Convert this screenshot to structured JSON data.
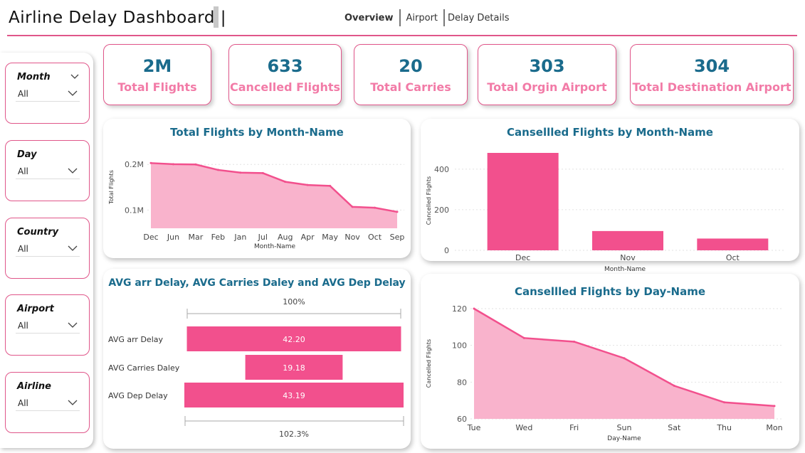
{
  "header": {
    "title": "Airline Delay Dashboard |",
    "nav": [
      {
        "label": "Overview",
        "active": true
      },
      {
        "label": "Airport",
        "active": false
      },
      {
        "label": "Delay Details",
        "active": false
      }
    ]
  },
  "slicers": [
    {
      "label": "Month",
      "value": "All"
    },
    {
      "label": "Day",
      "value": "All"
    },
    {
      "label": "Country",
      "value": "All"
    },
    {
      "label": "Airport",
      "value": "All"
    },
    {
      "label": "Airline",
      "value": "All"
    }
  ],
  "kpis": [
    {
      "value": "2M",
      "label": "Total Flights"
    },
    {
      "value": "633",
      "label": "Cancelled Flights"
    },
    {
      "value": "20",
      "label": "Total Carries"
    },
    {
      "value": "303",
      "label": "Total Orgin Airport"
    },
    {
      "value": "304",
      "label": "Total Destination Airport"
    }
  ],
  "colors": {
    "accent": "#e0568a",
    "bar": "#f2508d",
    "area_fill": "#f9b3cc",
    "title": "#1a6b8c",
    "kpi_label": "#f27ba7"
  },
  "chart_data": [
    {
      "type": "area",
      "title": "Total Flights by Month-Name",
      "xlabel": "Month-Name",
      "ylabel": "Total Flights",
      "categories": [
        "Dec",
        "Jun",
        "Mar",
        "Feb",
        "Jan",
        "Jul",
        "Aug",
        "Apr",
        "May",
        "Nov",
        "Oct",
        "Sep"
      ],
      "values": [
        203000,
        200500,
        200000,
        188000,
        182000,
        181000,
        162000,
        155000,
        153000,
        107000,
        105000,
        96000
      ],
      "yticks": [
        {
          "value": 100000,
          "label": "0.1M"
        },
        {
          "value": 200000,
          "label": "0.2M"
        }
      ],
      "ylim": [
        60000,
        230000
      ]
    },
    {
      "type": "bar",
      "title": "Cancelled Flights by Month-Name",
      "xlabel": "Month-Name",
      "ylabel": "Cancelled Flights",
      "categories": [
        "Dec",
        "Nov",
        "Oct"
      ],
      "values": [
        480,
        95,
        58
      ],
      "yticks": [
        {
          "value": 0,
          "label": "0"
        },
        {
          "value": 200,
          "label": "200"
        },
        {
          "value": 400,
          "label": "400"
        }
      ],
      "ylim": [
        0,
        480
      ]
    },
    {
      "type": "bar",
      "title": "AVG arr Delay, AVG Carries Daley and AVG Dep Delay",
      "orientation": "funnel",
      "categories": [
        "AVG arr Delay",
        "AVG Carries Daley",
        "AVG Dep Delay"
      ],
      "values": [
        42.2,
        19.18,
        43.19
      ],
      "value_labels": [
        "42.20",
        "19.18",
        "43.19"
      ],
      "top_label": "100%",
      "bottom_label": "102.3%"
    },
    {
      "type": "area",
      "title": "Cansellled Flights by Day-Name",
      "xlabel": "Day-Name",
      "ylabel": "Cancelled Flights",
      "categories": [
        "Tue",
        "Wed",
        "Fri",
        "Sun",
        "Sat",
        "Thu",
        "Mon"
      ],
      "values": [
        120,
        104,
        102,
        93,
        78,
        69,
        67
      ],
      "yticks": [
        {
          "value": 60,
          "label": "60"
        },
        {
          "value": 80,
          "label": "80"
        },
        {
          "value": 100,
          "label": "100"
        },
        {
          "value": 120,
          "label": "120"
        }
      ],
      "ylim": [
        60,
        120
      ]
    }
  ],
  "chart_titles": [
    "Total Flights by Month-Name",
    "Cansellled Flights by Month-Name",
    "AVG arr Delay, AVG Carries Daley and AVG Dep Delay",
    "Cansellled Flights by Day-Name"
  ]
}
